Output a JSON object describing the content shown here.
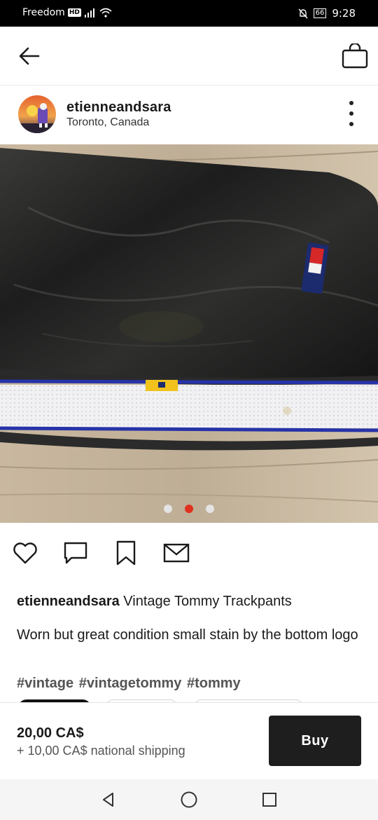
{
  "status_bar": {
    "carrier": "Freedom",
    "network_badge": "HD",
    "battery": "66",
    "time": "9:28",
    "icons": [
      "signal-icon",
      "wifi-icon",
      "bell-off-icon",
      "battery-icon"
    ]
  },
  "header": {
    "back_icon": "arrow-left-icon",
    "bag_icon": "shopping-bag-icon"
  },
  "seller": {
    "username": "etienneandsara",
    "location": "Toronto, Canada",
    "more_icon": "more-vertical-icon"
  },
  "gallery": {
    "image_count": 3,
    "active_index": 1,
    "active_color": "#e0301e",
    "inactive_color": "#e3e3e3"
  },
  "actions": {
    "icons": [
      "heart-icon",
      "comment-icon",
      "bookmark-icon",
      "message-icon"
    ]
  },
  "post": {
    "username": "etienneandsara",
    "title": "Vintage Tommy Trackpants",
    "description": "Worn but great condition small stain by the bottom logo",
    "hashtags": "#vintage #vintagetommy #tommy"
  },
  "purchase": {
    "price": "20,00 CA$",
    "shipping": "+ 10,00 CA$ national shipping",
    "buy_label": "Buy"
  },
  "nav": {
    "icons": [
      "back-triangle-icon",
      "home-circle-icon",
      "recents-square-icon"
    ]
  }
}
